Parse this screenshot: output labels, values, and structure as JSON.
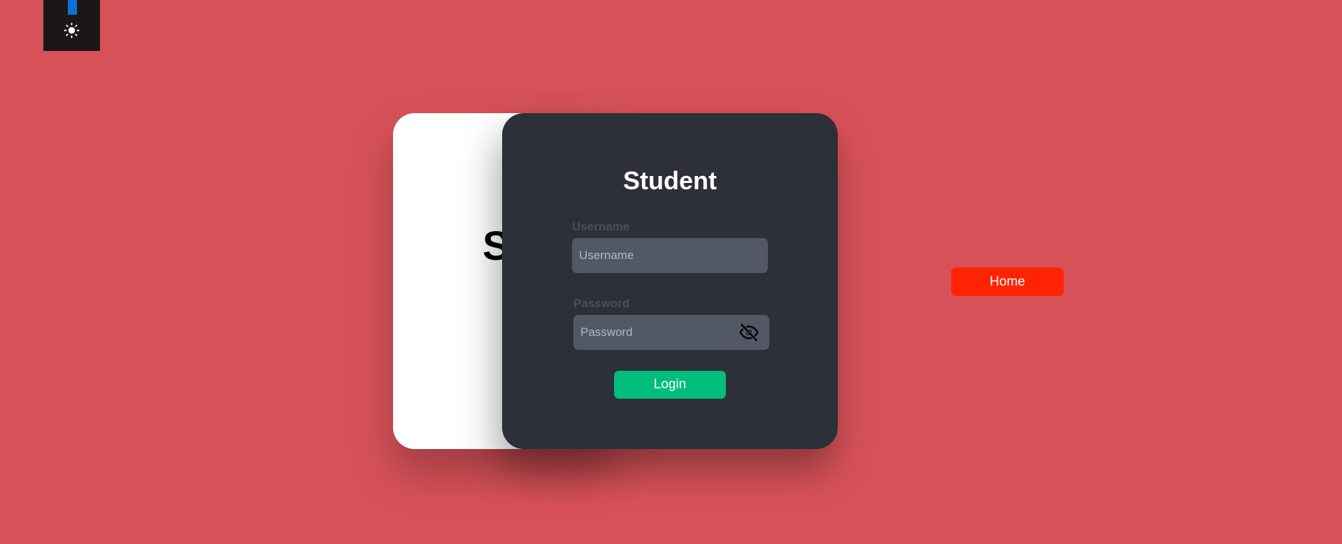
{
  "theme_toggle": {
    "icon": "sun-icon",
    "indicator_color": "#0f6fd8"
  },
  "back_card": {
    "title_partial": "S"
  },
  "login_card": {
    "title": "Student",
    "username": {
      "label": "Username",
      "placeholder": "Username",
      "value": ""
    },
    "password": {
      "label": "Password",
      "placeholder": "Password",
      "value": "",
      "visibility_icon": "eye-off-icon"
    },
    "login_label": "Login"
  },
  "nav": {
    "home_label": "Home"
  },
  "colors": {
    "background": "#d75258",
    "card_dark": "#2d3038",
    "card_light": "#ffffff",
    "input_bg": "#525866",
    "login_green": "#03bd7c",
    "home_red": "#ff2305",
    "toggle_panel": "#1c1717"
  }
}
